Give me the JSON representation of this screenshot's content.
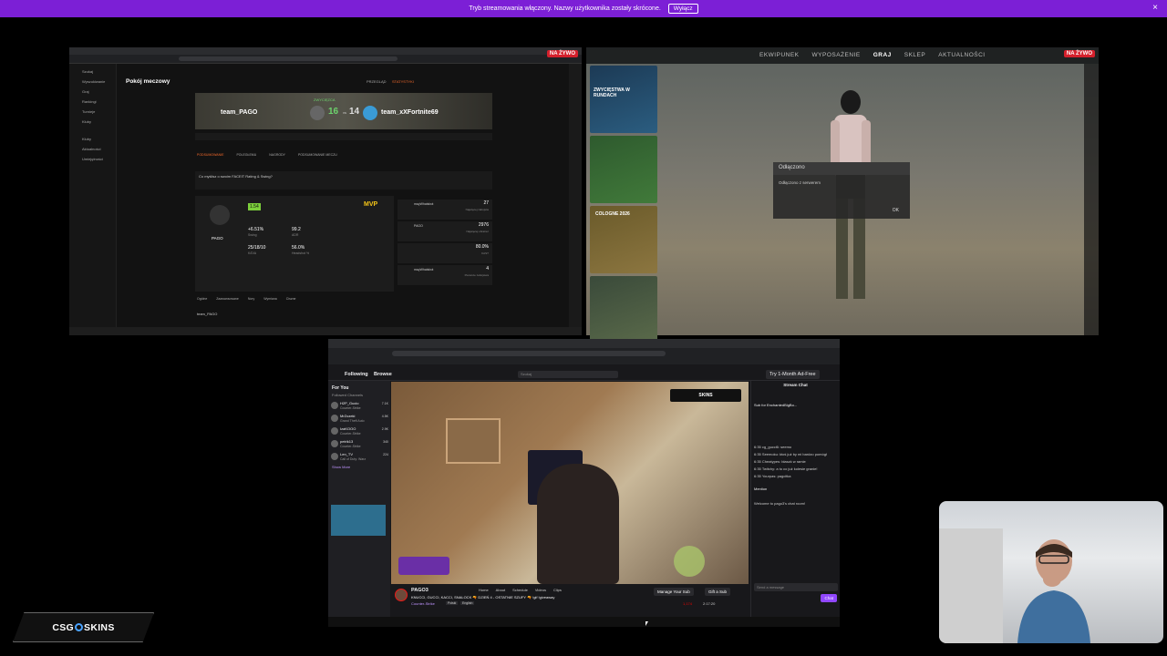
{
  "banner": {
    "text": "Tryb streamowania włączony. Nazwy użytkownika zostały skrócone.",
    "button": "Wyłącz",
    "close": "×"
  },
  "faceit": {
    "live": "NA ŻYWO",
    "page_title": "Pokój meczowy",
    "tabs": [
      "PRZEGLĄD",
      "STATYSTYKI"
    ],
    "team_a": "team_PAGO",
    "team_b": "team_xXFortnite69",
    "score_a": "16",
    "score_b": "14",
    "vs": "vs",
    "status": "ZWYCIĘZCA",
    "sub_tabs": [
      "PODSUMOWANIE",
      "POLEGŁEMU",
      "NAGRODY",
      "PODSUMOWANIE MECZU"
    ],
    "question": "Co myślisz o swoim FACEIT Rating & Swing?",
    "mvp_label": "MVP",
    "player": "PAGO",
    "rating_value": "1.54",
    "stats": [
      {
        "value": "+6.51%",
        "label": "Swing"
      },
      {
        "value": "99.2",
        "label": "ADR"
      },
      {
        "value": "25/18/10",
        "label": "K/D/A"
      },
      {
        "value": "56.0%",
        "label": "Headshot %"
      }
    ],
    "leaderboard": [
      {
        "name": "mayWhatsbot",
        "value": "27",
        "label": "Najwięcej zabójstw"
      },
      {
        "name": "PAGO",
        "value": "2976",
        "label": "Najwięcej obrażeń"
      },
      {
        "name": "",
        "value": "80.0%",
        "label": "KAST"
      },
      {
        "name": "mayWhatsbot",
        "value": "4",
        "label": "Pierwsze zabójstwa"
      }
    ],
    "table_tabs": [
      "Ogólne",
      "Zaawansowane",
      "Nory",
      "Wymiana",
      "Ciszne"
    ],
    "row_player": "team_PAGO",
    "sidebar": [
      "Szukaj",
      "Wyszukiwanie",
      "Graj",
      "Rankingi",
      "Turnieje",
      "Kluby",
      "Kluby",
      "Aktualności",
      "Umiejętności"
    ]
  },
  "cs2": {
    "live": "NA ŻYWO",
    "menu": [
      "EKWIPUNEK",
      "WYPOSAŻENIE",
      "GRAJ",
      "SKLEP",
      "AKTUALNOŚCI"
    ],
    "dialog_title": "Odłączono",
    "dialog_body": "Odłączono z serwerem",
    "dialog_ok": "OK",
    "cards": [
      "ZWYCIĘSTWA W RUNDACH",
      "",
      "COLOGNE 2026",
      ""
    ]
  },
  "twitch": {
    "nav": [
      "Following",
      "Browse"
    ],
    "search_placeholder": "Szukaj",
    "for_you": "For You",
    "followed": "Followed Channels",
    "channels": [
      {
        "name": "H2P_Gucio",
        "game": "Counter-Strike",
        "viewers": "7.1K"
      },
      {
        "name": "MrZozeki",
        "game": "Grand Theft Auto",
        "viewers": "4.5K"
      },
      {
        "name": "IzaKOOO",
        "game": "Counter-Strike",
        "viewers": "2.9K"
      },
      {
        "name": "petrik13",
        "game": "Counter-Strike",
        "viewers": "340"
      },
      {
        "name": "Len_TV",
        "game": "Call of Duty: Warz",
        "viewers": "224"
      }
    ],
    "show_more": "Show More",
    "stream_chat": "Stream Chat",
    "chat_lines": [
      "Sub for EnchantedBigBo...",
      "6:35 cg_gucci6: seemo",
      "6:35 Seemoku: ktoś już by mi bardzo pomógł",
      "6:35 Cheatypes: błaszk w ramie",
      "6:35 Twitchy: a to co już kolesie granie!",
      "6:35 Yourpas: pagcitka"
    ],
    "mention": "Mention",
    "welcome": "Welcome to pago3's chat room!",
    "send_placeholder": "Send a message",
    "chat_button": "Chat",
    "channel": "PAGO3",
    "title": "KNUCCI, GUCCI, KACCI, SNALOCK 🔫 DZIEŃ 4 - OSTATNIE SZUFY 🔫 !gif !giveaway",
    "game": "Counter-Strike",
    "tags": [
      "Polski",
      "English"
    ],
    "tabs": [
      "Home",
      "About",
      "Schedule",
      "Videos",
      "Clips"
    ],
    "manage_sub": "Manage Your Sub",
    "gift_sub": "Gift a Sub",
    "viewer_count": "1,174",
    "uptime": "2:17:20",
    "try_btn": "Try 1-Month Ad-Free",
    "banner_overlay": "SKINS"
  },
  "logo": {
    "left": "CSG",
    "right": "SKINS"
  }
}
